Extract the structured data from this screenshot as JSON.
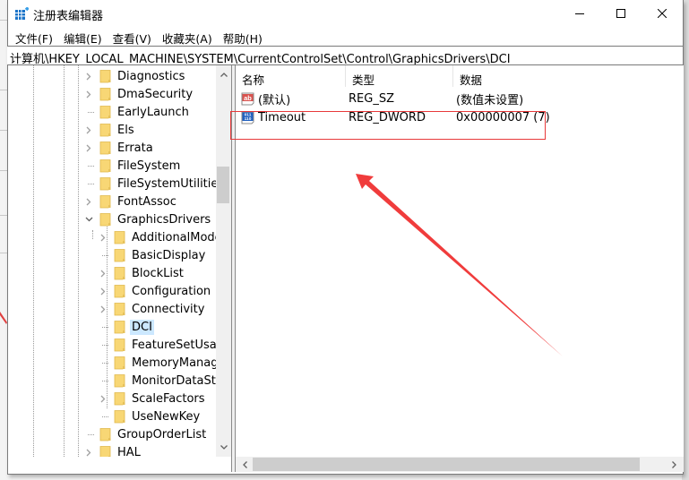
{
  "window": {
    "title": "注册表编辑器",
    "icon": "regedit-icon",
    "controls": {
      "minimize": "minimize-icon",
      "maximize": "maximize-icon",
      "close": "close-icon"
    }
  },
  "menubar": {
    "items": [
      {
        "label": "文件(F)"
      },
      {
        "label": "编辑(E)"
      },
      {
        "label": "查看(V)"
      },
      {
        "label": "收藏夹(A)"
      },
      {
        "label": "帮助(H)"
      }
    ]
  },
  "addressbar": {
    "path": "计算机\\HKEY_LOCAL_MACHINE\\SYSTEM\\CurrentControlSet\\Control\\GraphicsDrivers\\DCI"
  },
  "tree": {
    "items": [
      {
        "label": "Diagnostics",
        "level": 0,
        "expander": "collapsed"
      },
      {
        "label": "DmaSecurity",
        "level": 0,
        "expander": "collapsed"
      },
      {
        "label": "EarlyLaunch",
        "level": 0,
        "expander": "none"
      },
      {
        "label": "Els",
        "level": 0,
        "expander": "collapsed"
      },
      {
        "label": "Errata",
        "level": 0,
        "expander": "collapsed"
      },
      {
        "label": "FileSystem",
        "level": 0,
        "expander": "none"
      },
      {
        "label": "FileSystemUtilities",
        "level": 0,
        "expander": "none"
      },
      {
        "label": "FontAssoc",
        "level": 0,
        "expander": "collapsed"
      },
      {
        "label": "GraphicsDrivers",
        "level": 0,
        "expander": "expanded"
      },
      {
        "label": "AdditionalModeLists",
        "level": 1,
        "expander": "collapsed"
      },
      {
        "label": "BasicDisplay",
        "level": 1,
        "expander": "none"
      },
      {
        "label": "BlockList",
        "level": 1,
        "expander": "collapsed"
      },
      {
        "label": "Configuration",
        "level": 1,
        "expander": "collapsed"
      },
      {
        "label": "Connectivity",
        "level": 1,
        "expander": "collapsed"
      },
      {
        "label": "DCI",
        "level": 1,
        "expander": "none",
        "selected": true
      },
      {
        "label": "FeatureSetUsage",
        "level": 1,
        "expander": "none"
      },
      {
        "label": "MemoryManager",
        "level": 1,
        "expander": "none"
      },
      {
        "label": "MonitorDataStore",
        "level": 1,
        "expander": "none"
      },
      {
        "label": "ScaleFactors",
        "level": 1,
        "expander": "collapsed"
      },
      {
        "label": "UseNewKey",
        "level": 1,
        "expander": "none"
      },
      {
        "label": "GroupOrderList",
        "level": 0,
        "expander": "none"
      },
      {
        "label": "HAL",
        "level": 0,
        "expander": "collapsed"
      }
    ]
  },
  "list": {
    "columns": [
      {
        "label": "名称"
      },
      {
        "label": "类型"
      },
      {
        "label": "数据"
      }
    ],
    "rows": [
      {
        "icon": "string-value-icon",
        "name": "(默认)",
        "type": "REG_SZ",
        "data": "(数值未设置)"
      },
      {
        "icon": "dword-value-icon",
        "name": "Timeout",
        "type": "REG_DWORD",
        "data": "0x00000007 (7)"
      }
    ]
  },
  "annotations": {
    "highlight_color": "#e8393a",
    "highlight_target": "Timeout"
  },
  "colors": {
    "selection": "#cce8ff",
    "folder": "#f8d775"
  }
}
